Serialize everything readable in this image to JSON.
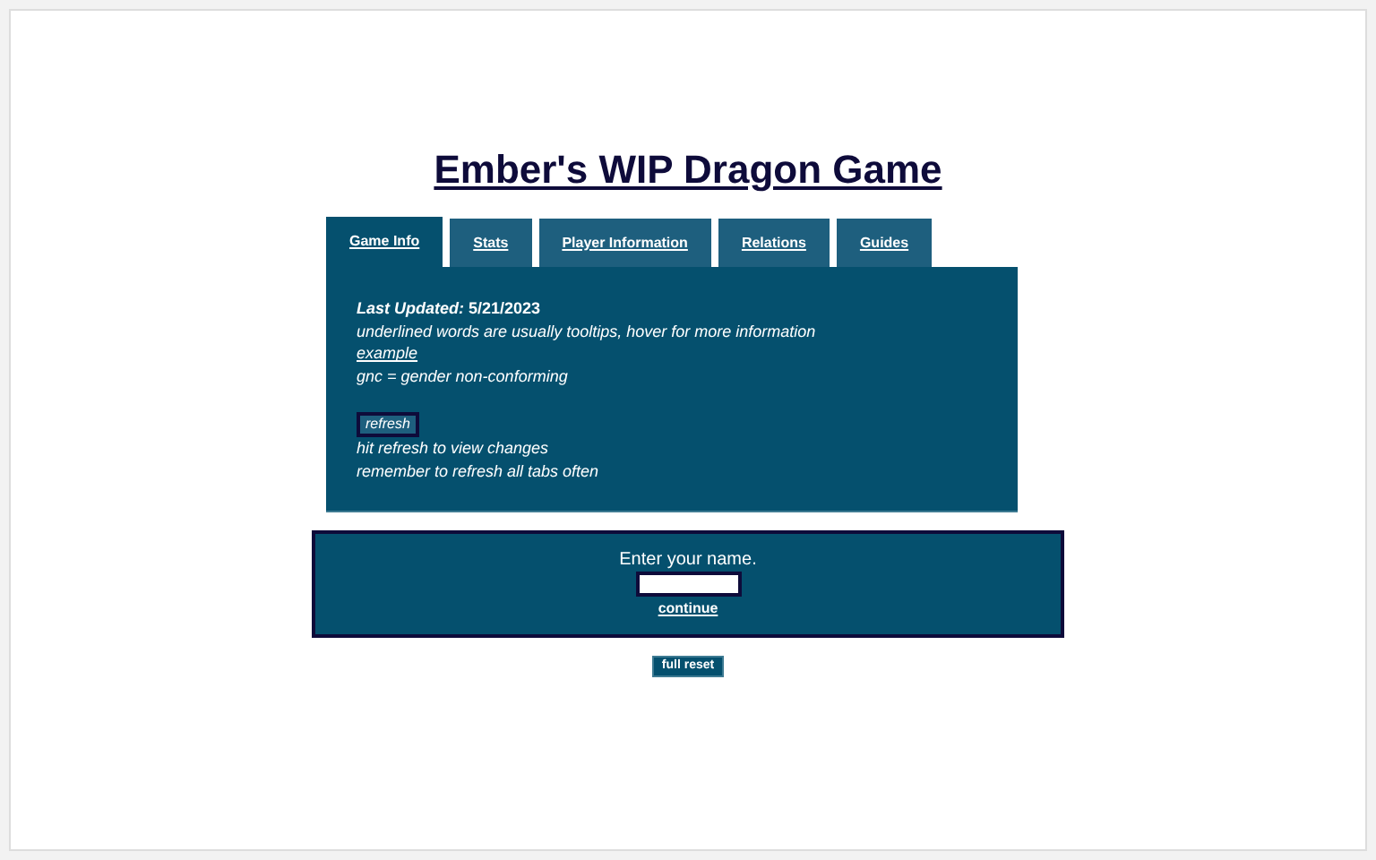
{
  "title": "Ember's WIP Dragon Game",
  "tabs": [
    {
      "label": "Game Info",
      "selected": true
    },
    {
      "label": "Stats",
      "selected": false
    },
    {
      "label": "Player Information",
      "selected": false
    },
    {
      "label": "Relations",
      "selected": false
    },
    {
      "label": "Guides",
      "selected": false
    }
  ],
  "info": {
    "updated": "*Last Updated:* 5/21/2023",
    "lines": [
      {
        "kind": "text",
        "text": "underlined words are usually tooltips, hover for more information"
      },
      {
        "kind": "tooltip",
        "text": "example"
      },
      {
        "kind": "text",
        "text": "gnc = gender non-conforming"
      }
    ],
    "refresh_button": "refresh",
    "notes": [
      "hit refresh to view changes",
      "remember to refresh all tabs often"
    ]
  },
  "name_prompt": {
    "label": "Enter your name.",
    "continue": "continue"
  },
  "reset_button": "full reset"
}
